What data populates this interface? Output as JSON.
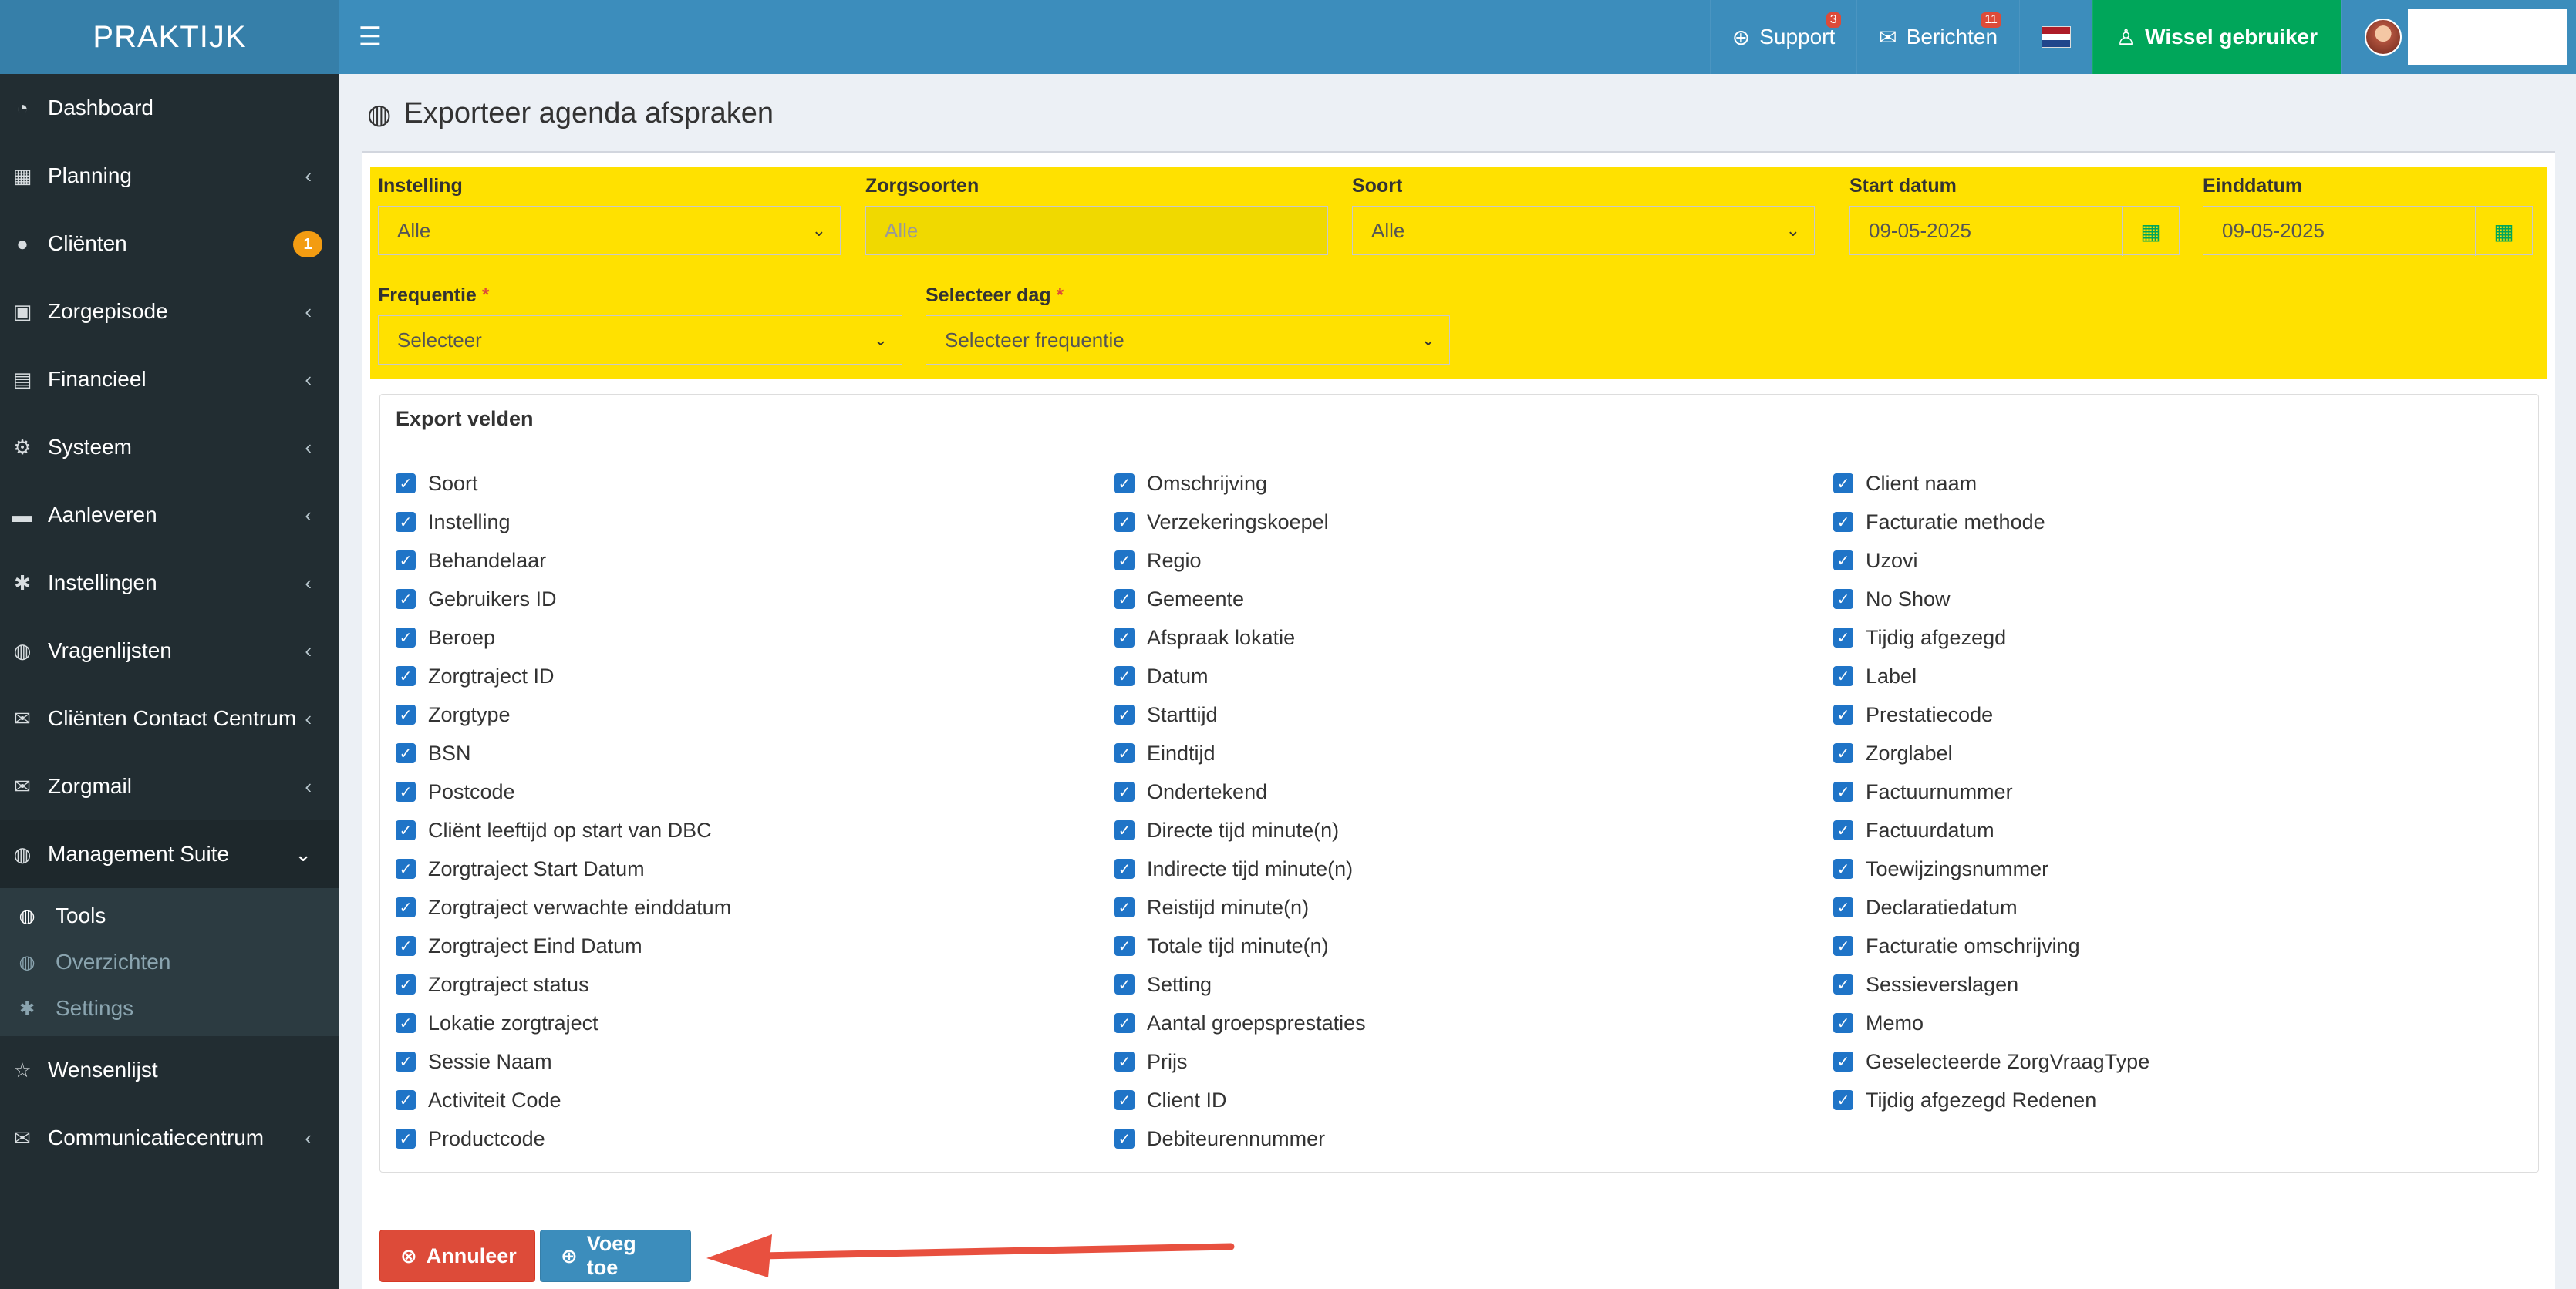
{
  "app": {
    "logo": "PRAKTIJK"
  },
  "header": {
    "menu_icon": "hamburger-icon",
    "support": {
      "label": "Support",
      "badge": "3"
    },
    "messages": {
      "label": "Berichten",
      "badge": "11"
    },
    "switch_user": {
      "label": "Wissel gebruiker"
    }
  },
  "sidebar": {
    "items": [
      {
        "label": "Dashboard",
        "icon": "dashboard-icon",
        "chevron": ""
      },
      {
        "label": "Planning",
        "icon": "calendar-icon",
        "chevron": "‹"
      },
      {
        "label": "Cliënten",
        "icon": "user-icon",
        "badge": "1"
      },
      {
        "label": "Zorgepisode",
        "icon": "camera-icon",
        "chevron": "‹"
      },
      {
        "label": "Financieel",
        "icon": "book-icon",
        "chevron": "‹"
      },
      {
        "label": "Systeem",
        "icon": "cogs-icon",
        "chevron": "‹"
      },
      {
        "label": "Aanleveren",
        "icon": "truck-icon",
        "chevron": "‹"
      },
      {
        "label": "Instellingen",
        "icon": "gear-icon",
        "chevron": "‹"
      },
      {
        "label": "Vragenlijsten",
        "icon": "globe-icon",
        "chevron": "‹"
      },
      {
        "label": "Cliënten Contact Centrum",
        "icon": "envelope-icon",
        "chevron": "‹"
      },
      {
        "label": "Zorgmail",
        "icon": "envelope-icon",
        "chevron": "‹"
      },
      {
        "label": "Management Suite",
        "icon": "globe-icon",
        "chevron": "⌄"
      }
    ],
    "sub_items": [
      {
        "label": "Tools",
        "icon": "globe-icon"
      },
      {
        "label": "Overzichten",
        "icon": "globe-icon"
      },
      {
        "label": "Settings",
        "icon": "gear-icon"
      }
    ],
    "bottom_items": [
      {
        "label": "Wensenlijst",
        "icon": "star-icon",
        "chevron": ""
      },
      {
        "label": "Communicatiecentrum",
        "icon": "envelope-icon",
        "chevron": "‹"
      }
    ]
  },
  "page": {
    "title": "Exporteer agenda afspraken"
  },
  "filters": {
    "instelling": {
      "label": "Instelling",
      "value": "Alle"
    },
    "zorgsoorten": {
      "label": "Zorgsoorten",
      "placeholder": "Alle"
    },
    "soort": {
      "label": "Soort",
      "value": "Alle"
    },
    "start_datum": {
      "label": "Start datum",
      "value": "09-05-2025"
    },
    "einddatum": {
      "label": "Einddatum",
      "value": "09-05-2025"
    },
    "frequentie": {
      "label": "Frequentie",
      "required": "*",
      "value": "Selecteer"
    },
    "selecteer_dag": {
      "label": "Selecteer dag",
      "required": "*",
      "value": "Selecteer frequentie"
    }
  },
  "export": {
    "title": "Export velden",
    "columns": [
      [
        "Soort",
        "Instelling",
        "Behandelaar",
        "Gebruikers ID",
        "Beroep",
        "Zorgtraject ID",
        "Zorgtype",
        "BSN",
        "Postcode",
        "Cliënt leeftijd op start van DBC",
        "Zorgtraject Start Datum",
        "Zorgtraject verwachte einddatum",
        "Zorgtraject Eind Datum",
        "Zorgtraject status",
        "Lokatie zorgtraject",
        "Sessie Naam",
        "Activiteit Code",
        "Productcode"
      ],
      [
        "Omschrijving",
        "Verzekeringskoepel",
        "Regio",
        "Gemeente",
        "Afspraak lokatie",
        "Datum",
        "Starttijd",
        "Eindtijd",
        "Ondertekend",
        "Directe tijd minute(n)",
        "Indirecte tijd minute(n)",
        "Reistijd minute(n)",
        "Totale tijd minute(n)",
        "Setting",
        "Aantal groepsprestaties",
        "Prijs",
        "Client ID",
        "Debiteurennummer"
      ],
      [
        "Client naam",
        "Facturatie methode",
        "Uzovi",
        "No Show",
        "Tijdig afgezegd",
        "Label",
        "Prestatiecode",
        "Zorglabel",
        "Factuurnummer",
        "Factuurdatum",
        "Toewijzingsnummer",
        "Declaratiedatum",
        "Facturatie omschrijving",
        "Sessieverslagen",
        "Memo",
        "Geselecteerde ZorgVraagType",
        "Tijdig afgezegd Redenen"
      ]
    ]
  },
  "actions": {
    "cancel": "Annuleer",
    "add": "Voeg toe"
  },
  "colors": {
    "header": "#3c8dbc",
    "logo_bg": "#367fa9",
    "sidebar": "#222d32",
    "filter_bg": "#ffe100",
    "switch_user_bg": "#00a65a",
    "cancel_btn": "#dd4b39",
    "add_btn": "#3c8dbc",
    "checkbox": "#1f74c7",
    "arrow": "#e8503f"
  }
}
